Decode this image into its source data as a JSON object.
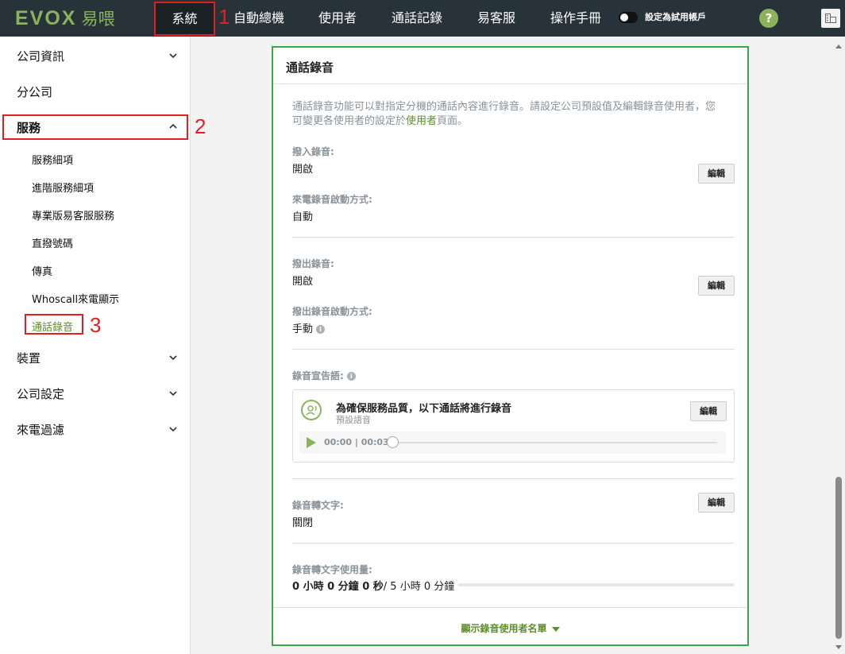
{
  "header": {
    "logo_text": "EVOX",
    "logo_cn": "易喂",
    "nav": [
      "系統",
      "自動總機",
      "使用者",
      "通話記錄",
      "易客服",
      "操作手冊"
    ],
    "trial_label": "設定為試用帳戶",
    "help_label": "?",
    "annotation_1": "1"
  },
  "sidebar": {
    "company_info": "公司資訊",
    "branch": "分公司",
    "services": "服務",
    "services_sub": [
      "服務細項",
      "進階服務細項",
      "專業版易客服服務",
      "直撥號碼",
      "傳真",
      "Whoscall來電顯示",
      "通話錄音"
    ],
    "devices": "裝置",
    "company_settings": "公司設定",
    "call_filter": "來電過濾",
    "annotation_2": "2",
    "annotation_3": "3"
  },
  "card": {
    "title": "通話錄音",
    "description_part1": "通話錄音功能可以對指定分機的通話內容進行錄音。請設定公司預設值及編輯錄音使用者，您可變更各使用者的設定於",
    "description_link": "使用者",
    "description_part2": "頁面。",
    "edit_label": "編輯",
    "inbound_label": "撥入錄音:",
    "inbound_value": "開啟",
    "inbound_mode_label": "來電錄音啟動方式:",
    "inbound_mode_value": "自動",
    "outbound_label": "撥出錄音:",
    "outbound_value": "開啟",
    "outbound_mode_label": "撥出錄音啟動方式:",
    "outbound_mode_value": "手動",
    "announce_label": "錄音宣告語:",
    "announce_title": "為確保服務品質，以下通話將進行錄音",
    "announce_sub": "預設語音",
    "player_time": "00:00 | 00:03",
    "stt_label": "錄音轉文字:",
    "stt_value": "關閉",
    "usage_label": "錄音轉文字使用量:",
    "usage_used": "0 小時 0 分鐘 0 秒",
    "usage_total": "/ 5 小時 0 分鐘",
    "usage_fraction": 0,
    "show_users": "顯示錄音使用者名單"
  },
  "colors": {
    "accent": "#8cb35a",
    "annotation": "#e02020",
    "card_border": "#3aa849",
    "topbar": "#283339"
  },
  "icons": [
    "chevron-down-icon",
    "chevron-up-icon",
    "help-icon",
    "info-icon",
    "voice-icon",
    "play-icon",
    "building-icon"
  ]
}
